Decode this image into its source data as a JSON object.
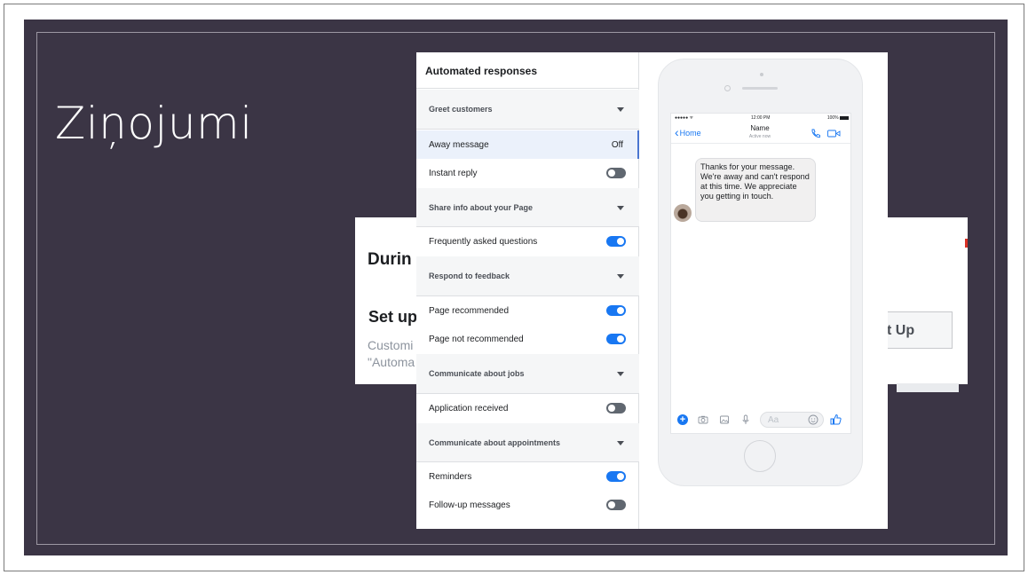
{
  "slide": {
    "title": "Ziņojumi"
  },
  "background_card": {
    "heading_fragment": "Durin",
    "setup_fragment": "Set up",
    "description_line1": "Customi",
    "description_line2": "\"Automa",
    "button_fragment": "t Up"
  },
  "panel": {
    "title": "Automated responses",
    "sections": [
      {
        "label": "Greet customers",
        "items": [
          {
            "label": "Away message",
            "status": "Off",
            "active": true
          },
          {
            "label": "Instant reply",
            "toggle": "off"
          }
        ]
      },
      {
        "label": "Share info about your Page",
        "items": [
          {
            "label": "Frequently asked questions",
            "toggle": "on"
          }
        ]
      },
      {
        "label": "Respond to feedback",
        "items": [
          {
            "label": "Page recommended",
            "toggle": "on"
          },
          {
            "label": "Page not recommended",
            "toggle": "on"
          }
        ]
      },
      {
        "label": "Communicate about jobs",
        "items": [
          {
            "label": "Application received",
            "toggle": "off"
          }
        ]
      },
      {
        "label": "Communicate about appointments",
        "items": [
          {
            "label": "Reminders",
            "toggle": "on"
          },
          {
            "label": "Follow-up messages",
            "toggle": "off"
          }
        ]
      }
    ]
  },
  "phone": {
    "status_signal": "●●●●● ᯤ",
    "status_time": "12:00 PM",
    "status_battery": "100%",
    "back_label": "Home",
    "contact_name": "Name",
    "contact_status": "Active now",
    "message": "Thanks for your message. We're away and can't respond at this time. We appreciate you getting in touch.",
    "input_placeholder": "Aa"
  },
  "colors": {
    "slide_bg": "#3b3545",
    "accent": "#1877f2",
    "toggle_off": "#606770"
  }
}
